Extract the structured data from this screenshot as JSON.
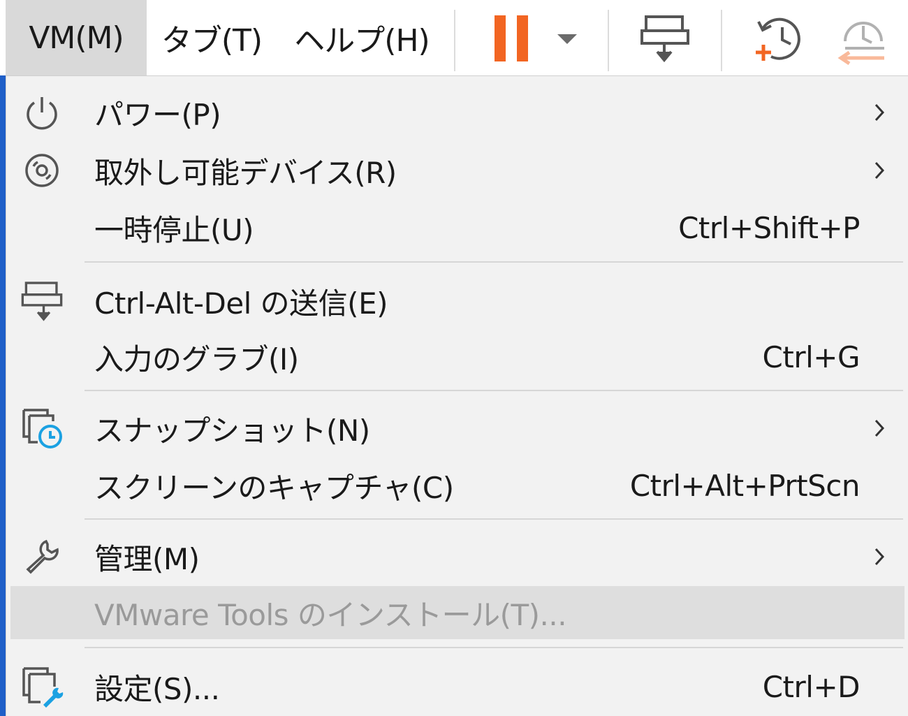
{
  "menubar": {
    "items": [
      {
        "label": "VM(M)"
      },
      {
        "label": "タブ(T)"
      },
      {
        "label": "ヘルプ(H)"
      }
    ],
    "toolbar_icons": [
      "pause-icon",
      "dropdown-arrow-icon",
      "send-ctrl-alt-del-icon",
      "take-snapshot-icon",
      "revert-snapshot-icon"
    ]
  },
  "menu": {
    "items": [
      {
        "label": "パワー(P)",
        "shortcut": "",
        "submenu": true,
        "icon": "power-icon"
      },
      {
        "label": "取外し可能デバイス(R)",
        "shortcut": "",
        "submenu": true,
        "icon": "disc-icon"
      },
      {
        "label": "一時停止(U)",
        "shortcut": "Ctrl+Shift+P",
        "submenu": false,
        "icon": ""
      },
      {
        "label": "Ctrl-Alt-Del の送信(E)",
        "shortcut": "",
        "submenu": false,
        "icon": "send-ctrl-alt-del-icon"
      },
      {
        "label": "入力のグラブ(I)",
        "shortcut": "Ctrl+G",
        "submenu": false,
        "icon": ""
      },
      {
        "label": "スナップショット(N)",
        "shortcut": "",
        "submenu": true,
        "icon": "snapshot-icon"
      },
      {
        "label": "スクリーンのキャプチャ(C)",
        "shortcut": "Ctrl+Alt+PrtScn",
        "submenu": false,
        "icon": ""
      },
      {
        "label": "管理(M)",
        "shortcut": "",
        "submenu": true,
        "icon": "wrench-icon"
      },
      {
        "label": "VMware Tools のインストール(T)...",
        "shortcut": "",
        "submenu": false,
        "icon": "",
        "disabled": true,
        "highlighted": true
      },
      {
        "label": "設定(S)...",
        "shortcut": "Ctrl+D",
        "submenu": false,
        "icon": "settings-icon"
      }
    ]
  },
  "colors": {
    "accent_orange": "#f26522",
    "accent_cyan": "#1ba1e2",
    "menu_bg": "#f2f2f2",
    "highlight_bg": "#dedede",
    "disabled_text": "#9a9a9a"
  }
}
